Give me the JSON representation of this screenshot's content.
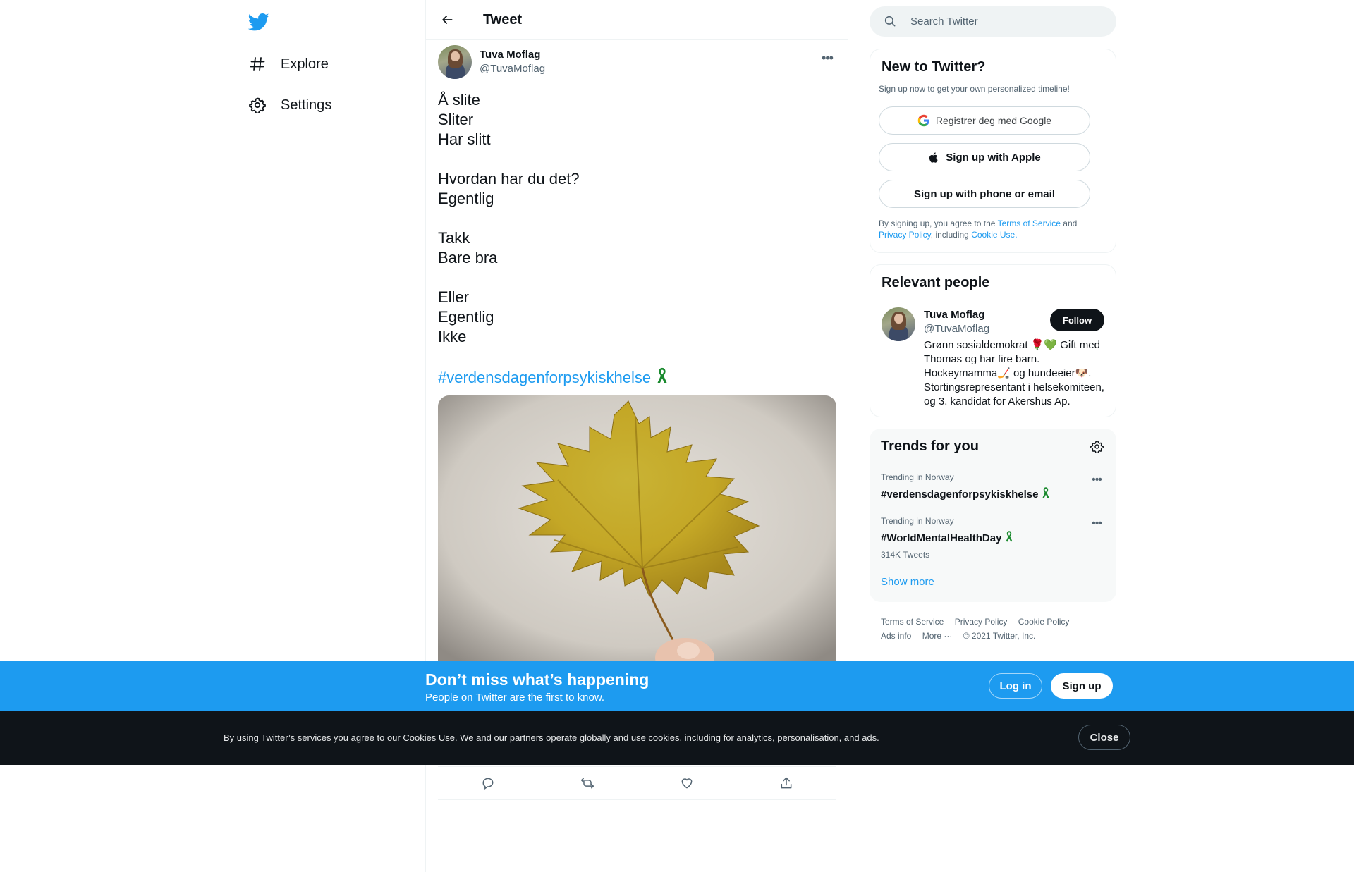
{
  "nav": {
    "items": [
      {
        "label": "Explore",
        "icon": "hashtag-icon"
      },
      {
        "label": "Settings",
        "icon": "gear-icon"
      }
    ]
  },
  "main": {
    "header_title": "Tweet",
    "tweet": {
      "author_name": "Tuva Moflag",
      "author_handle": "@TuvaMoflag",
      "lines": [
        "Å slite",
        "Sliter",
        "Har slitt",
        "",
        "Hvordan har du det?",
        "Egentlig",
        "",
        "Takk",
        "Bare bra",
        "",
        "Eller",
        "Egentlig",
        "Ikke"
      ],
      "hashtag": "#verdensdagenforpsykiskhelse",
      "media_description": "photo-leaf"
    }
  },
  "search": {
    "placeholder": "Search Twitter"
  },
  "signup_card": {
    "title": "New to Twitter?",
    "subtitle": "Sign up now to get your own personalized timeline!",
    "google_label": "Registrer deg med Google",
    "apple_label": "Sign up with Apple",
    "phone_label": "Sign up with phone or email",
    "legal_prefix": "By signing up, you agree to the",
    "terms": "Terms of Service",
    "and": "and",
    "privacy": "Privacy Policy",
    "including": ", including",
    "cookie_use": "Cookie Use."
  },
  "relevant_people": {
    "title": "Relevant people",
    "name": "Tuva Moflag",
    "handle": "@TuvaMoflag",
    "follow_label": "Follow",
    "bio": "Grønn sosialdemokrat 🌹💚 Gift med Thomas og har fire barn. Hockeymamma🏒 og hundeeier🐶. Stortingsrepresentant i helsekomiteen, og 3. kandidat for Akershus Ap."
  },
  "trends": {
    "title": "Trends for you",
    "items": [
      {
        "context": "Trending in Norway",
        "tag": "#verdensdagenforpsykiskhelse",
        "count": ""
      },
      {
        "context": "Trending in Norway",
        "tag": "#WorldMentalHealthDay",
        "count": "314K Tweets"
      }
    ],
    "show_more": "Show more"
  },
  "footer": {
    "terms": "Terms of Service",
    "privacy": "Privacy Policy",
    "cookie": "Cookie Policy",
    "ads": "Ads info",
    "more": "More ···",
    "copyright": "© 2021 Twitter, Inc."
  },
  "promo": {
    "title": "Don’t miss what’s happening",
    "subtitle": "People on Twitter are the first to know.",
    "login": "Log in",
    "signup": "Sign up"
  },
  "cookie": {
    "text": "By using Twitter’s services you agree to our Cookies Use. We and our partners operate globally and use cookies, including for analytics, personalisation, and ads.",
    "close": "Close"
  },
  "colors": {
    "brand": "#1d9bf0",
    "text": "#0f1419",
    "muted": "#536471",
    "cookie_bg": "#0f1419",
    "ribbon": "#1a8a2e"
  }
}
